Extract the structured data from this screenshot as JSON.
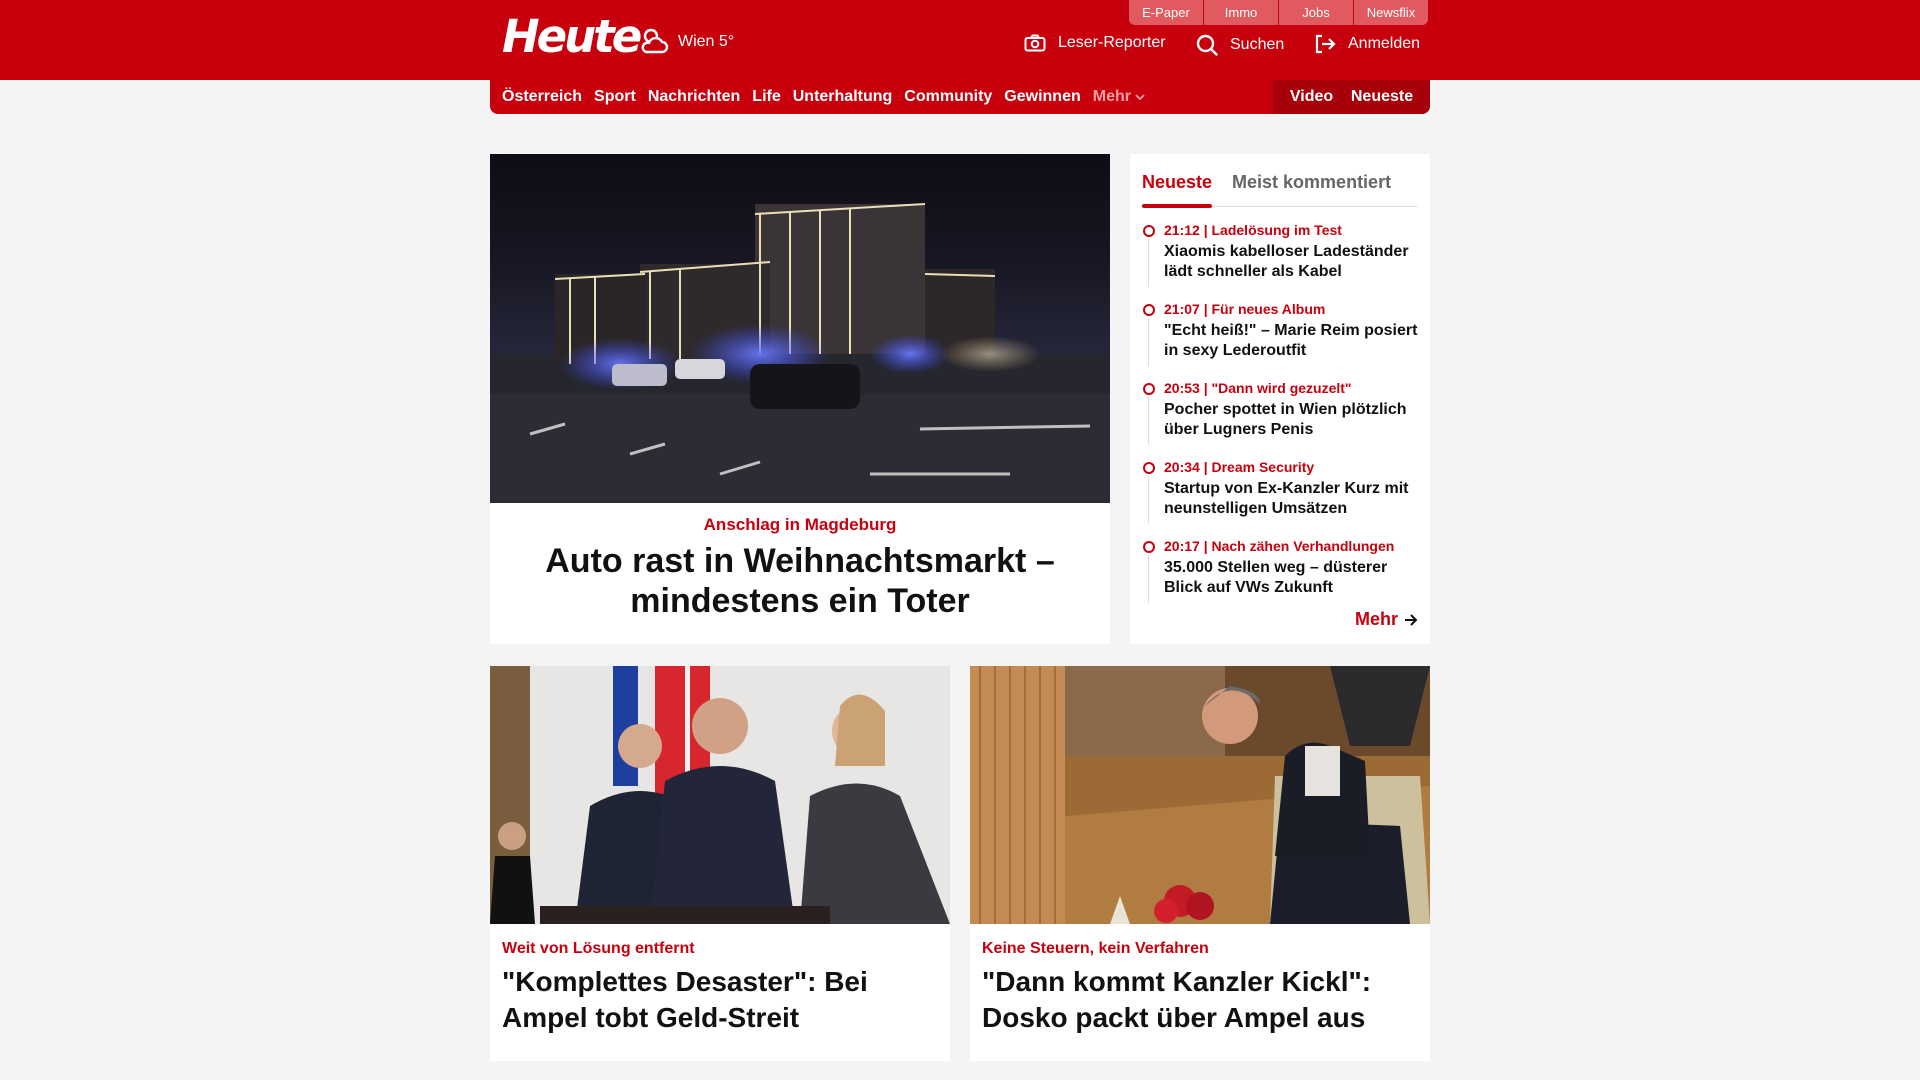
{
  "top_links": [
    "E-Paper",
    "Immo",
    "Jobs",
    "Newsflix"
  ],
  "logo": "Heute",
  "weather": "Wien 5°",
  "header_actions": {
    "reporter": "Leser-Reporter",
    "search": "Suchen",
    "login": "Anmelden"
  },
  "nav": {
    "items": [
      "Österreich",
      "Sport",
      "Nachrichten",
      "Life",
      "Unterhaltung",
      "Community",
      "Gewinnen"
    ],
    "more": "Mehr",
    "video": "Video",
    "latest": "Neueste"
  },
  "hero": {
    "kicker": "Anschlag in Magdeburg",
    "title": "Auto rast in Weihnachtsmarkt – mindestens ein Toter"
  },
  "sidebar": {
    "tab_active": "Neueste",
    "tab_inactive": "Meist kommentiert",
    "items": [
      {
        "meta": "21:12 | Ladelösung im Test",
        "title": "Xiaomis kabelloser Ladeständer lädt schneller als Kabel"
      },
      {
        "meta": "21:07 | Für neues Album",
        "title": "\"Echt heiß!\" – Marie Reim posiert in sexy Lederoutfit"
      },
      {
        "meta": "20:53 | \"Dann wird gezuzelt\"",
        "title": "Pocher spottet in Wien plötzlich über Lugners Penis"
      },
      {
        "meta": "20:34 | Dream Security",
        "title": "Startup von Ex-Kanzler Kurz mit neunstelligen Umsätzen"
      },
      {
        "meta": "20:17 | Nach zähen Verhandlungen",
        "title": "35.000 Stellen weg – düsterer Blick auf VWs Zukunft"
      }
    ],
    "more": "Mehr"
  },
  "cards": [
    {
      "kicker": "Weit von Lösung entfernt",
      "title": "\"Komplettes Desaster\": Bei Ampel tobt Geld-Streit"
    },
    {
      "kicker": "Keine Steuern, kein Verfahren",
      "title": "\"Dann kommt Kanzler Kickl\": Dosko packt über Ampel aus"
    }
  ],
  "colors": {
    "brand": "#c8000d",
    "page_bg": "#f4f4f4"
  }
}
